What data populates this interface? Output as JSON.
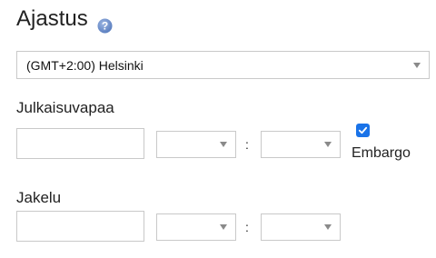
{
  "schedule": {
    "title": "Ajastus",
    "help_icon": "question-mark-icon",
    "timezone": "(GMT+2:00) Helsinki"
  },
  "publish": {
    "label": "Julkaisuvapaa",
    "date_value": "",
    "hour_value": "",
    "minute_value": "",
    "separator": ":",
    "embargo_label": "Embargo",
    "embargo_checked": true
  },
  "distribution": {
    "label": "Jakelu",
    "date_value": "",
    "hour_value": "",
    "minute_value": "",
    "separator": ":"
  },
  "colors": {
    "accent": "#1a73e8",
    "help_icon": "#6f8fc7",
    "border": "#c9c9c9"
  }
}
